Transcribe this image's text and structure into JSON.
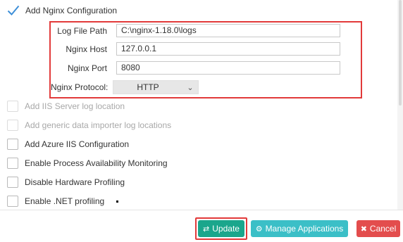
{
  "options": {
    "add_nginx": {
      "label": "Add Nginx Configuration",
      "checked": true
    },
    "add_iis_log": {
      "label": "Add IIS Server log location",
      "disabled": true
    },
    "add_generic": {
      "label": "Add generic data importer log locations",
      "disabled": true
    },
    "add_azure": {
      "label": "Add Azure IIS Configuration"
    },
    "enable_process": {
      "label": "Enable Process Availability Monitoring"
    },
    "disable_hw": {
      "label": "Disable Hardware Profiling"
    },
    "enable_net": {
      "label": "Enable .NET profiling"
    }
  },
  "nginx": {
    "log_file_path": {
      "label": "Log File Path",
      "value": "C:\\nginx-1.18.0\\logs"
    },
    "host": {
      "label": "Nginx Host",
      "value": "127.0.0.1"
    },
    "port": {
      "label": "Nginx Port",
      "value": "8080"
    },
    "protocol": {
      "label": "Nginx Protocol:",
      "value": "HTTP"
    }
  },
  "buttons": {
    "update": "Update",
    "manage": "Manage Applications",
    "cancel": "Cancel"
  },
  "colors": {
    "update": "#1aa68c",
    "manage": "#3bbfc7",
    "cancel": "#e34d4d",
    "highlight": "#e23a3a",
    "check": "#3d8fd8"
  }
}
